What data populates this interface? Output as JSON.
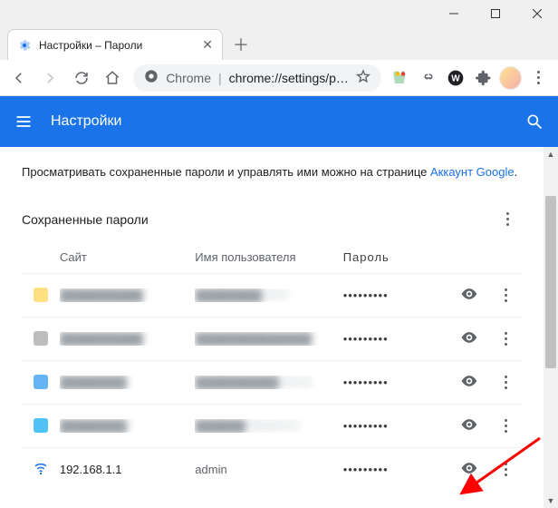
{
  "window": {
    "tab_title": "Настройки – Пароли"
  },
  "omnibox": {
    "label": "Chrome",
    "url": "chrome://settings/p…"
  },
  "appbar": {
    "title": "Настройки"
  },
  "intro": {
    "text_before": "Просматривать сохраненные пароли и управлять ими можно на странице ",
    "link": "Аккаунт Google",
    "text_after": "."
  },
  "section": {
    "title": "Сохраненные пароли"
  },
  "columns": {
    "site": "Сайт",
    "user": "Имя пользователя",
    "pass": "Пароль"
  },
  "rows": [
    {
      "site": "██████████",
      "site_blur": true,
      "user": "████████",
      "user_blur": true,
      "pass": "•••••••••",
      "fav_color": "#ffe082",
      "wifi": false
    },
    {
      "site": "██████████",
      "site_blur": true,
      "user": "██████████████",
      "user_blur": true,
      "pass": "•••••••••",
      "fav_color": "#bdbdbd",
      "wifi": false
    },
    {
      "site": "████████",
      "site_blur": true,
      "user": "██████████",
      "user_blur": true,
      "pass": "•••••••••",
      "fav_color": "#64b5f6",
      "wifi": false
    },
    {
      "site": "████████",
      "site_blur": true,
      "user": "██████",
      "user_blur": true,
      "pass": "•••••••••",
      "fav_color": "#4fc3f7",
      "wifi": false
    },
    {
      "site": "192.168.1.1",
      "site_blur": false,
      "user": "admin",
      "user_blur": false,
      "pass": "•••••••••",
      "fav_color": "#1a73e8",
      "wifi": true
    }
  ]
}
